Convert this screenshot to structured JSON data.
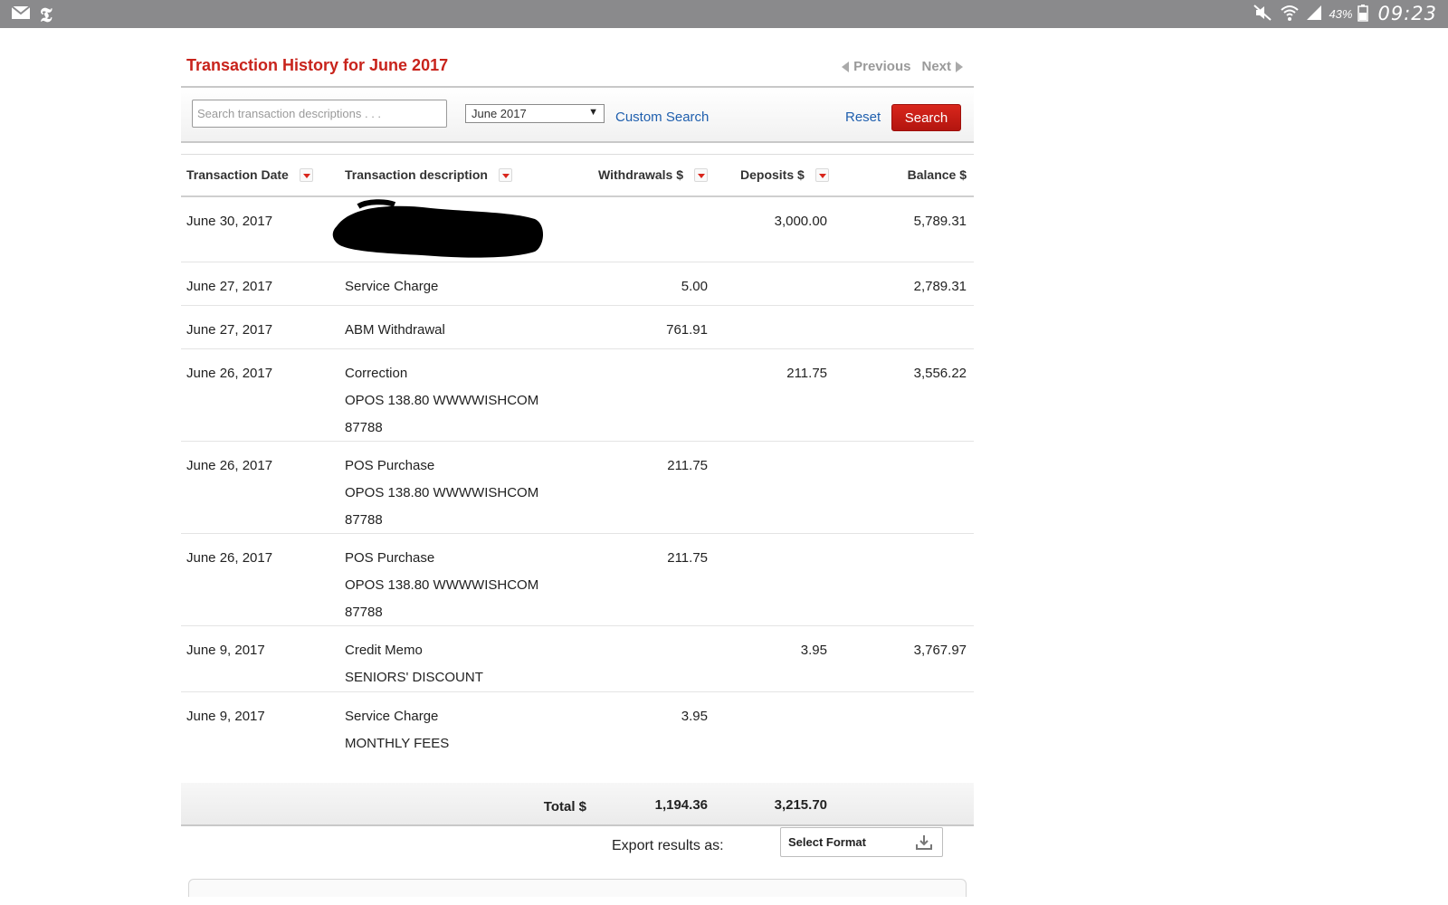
{
  "header": {
    "title": "Transaction History for June 2017",
    "previous_label": "Previous",
    "next_label": "Next"
  },
  "statusbar": {
    "battery_pct": "43%",
    "time": "09:23"
  },
  "search": {
    "placeholder": "Search transaction descriptions . . .",
    "month_value": "June 2017",
    "custom_search_label": "Custom Search",
    "reset_label": "Reset",
    "search_label": "Search"
  },
  "table": {
    "columns": [
      "Transaction Date",
      "Transaction description",
      "Withdrawals $",
      "Deposits $",
      "Balance $"
    ],
    "rows": [
      {
        "date": "June 30, 2017",
        "desc1": "",
        "desc2": "",
        "desc3": "",
        "withdrawal": "",
        "deposit": "3,000.00",
        "balance": "5,789.31"
      },
      {
        "date": "June 27, 2017",
        "desc1": "Service Charge",
        "desc2": "",
        "desc3": "",
        "withdrawal": "5.00",
        "deposit": "",
        "balance": "2,789.31"
      },
      {
        "date": "June 27, 2017",
        "desc1": "ABM Withdrawal",
        "desc2": "",
        "desc3": "",
        "withdrawal": "761.91",
        "deposit": "",
        "balance": ""
      },
      {
        "date": "June 26, 2017",
        "desc1": "Correction",
        "desc2": "OPOS 138.80 WWWWISHCOM",
        "desc3": "87788",
        "withdrawal": "",
        "deposit": "211.75",
        "balance": "3,556.22"
      },
      {
        "date": "June 26, 2017",
        "desc1": "POS Purchase",
        "desc2": "OPOS 138.80 WWWWISHCOM",
        "desc3": "87788",
        "withdrawal": "211.75",
        "deposit": "",
        "balance": ""
      },
      {
        "date": "June 26, 2017",
        "desc1": "POS Purchase",
        "desc2": "OPOS 138.80 WWWWISHCOM",
        "desc3": "87788",
        "withdrawal": "211.75",
        "deposit": "",
        "balance": ""
      },
      {
        "date": "June 9, 2017",
        "desc1": "Credit Memo",
        "desc2": "SENIORS' DISCOUNT",
        "desc3": "",
        "withdrawal": "",
        "deposit": "3.95",
        "balance": "3,767.97"
      },
      {
        "date": "June 9, 2017",
        "desc1": "Service Charge",
        "desc2": "MONTHLY FEES",
        "desc3": "",
        "withdrawal": "3.95",
        "deposit": "",
        "balance": ""
      }
    ],
    "totals": {
      "label": "Total $",
      "withdrawals": "1,194.36",
      "deposits": "3,215.70"
    }
  },
  "export": {
    "label": "Export results as:",
    "select_label": "Select Format"
  },
  "colors": {
    "accent_red": "#c8231b",
    "link_blue": "#1f5fae",
    "statusbar_gray": "#8a8a8c"
  },
  "icons": [
    "mail-icon",
    "nyt-icon",
    "mute-icon",
    "wifi-icon",
    "signal-icon",
    "battery-icon",
    "sort-icon",
    "download-icon"
  ]
}
